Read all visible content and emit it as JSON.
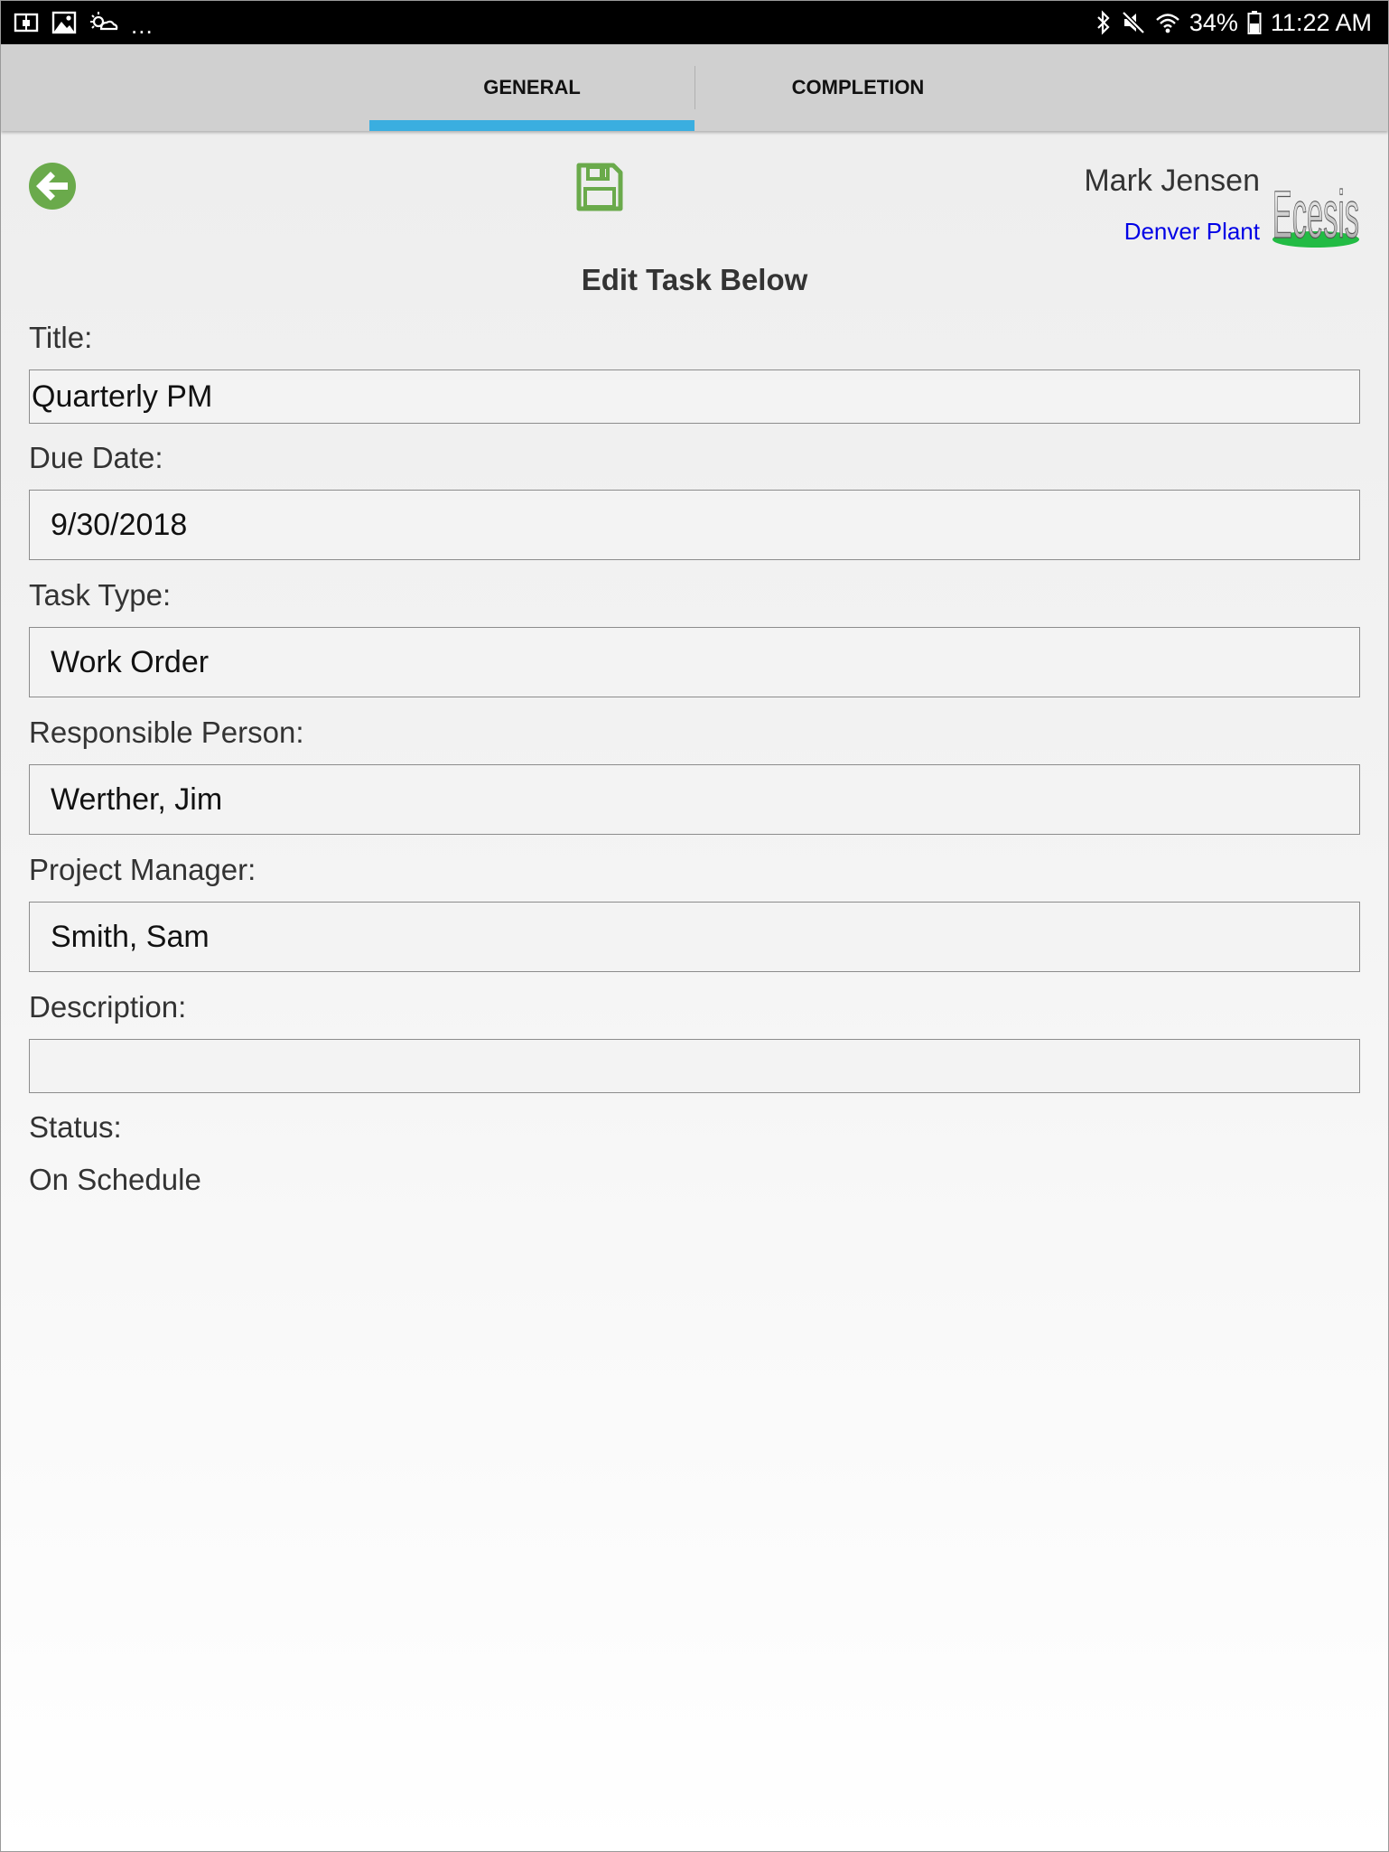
{
  "status_bar": {
    "dots": "...",
    "battery": "34%",
    "time": "11:22 AM"
  },
  "tabs": [
    {
      "label": "GENERAL",
      "active": true
    },
    {
      "label": "COMPLETION",
      "active": false
    }
  ],
  "header": {
    "user_name": "Mark Jensen",
    "plant": "Denver Plant",
    "logo_text": "Ecesis",
    "accent_color": "#6aaa4b",
    "tab_indicator_color": "#3aaee0",
    "plant_color": "#0000e6"
  },
  "form": {
    "heading": "Edit Task Below",
    "title_label": "Title:",
    "title_value": "Quarterly PM",
    "due_date_label": "Due Date:",
    "due_date_value": "9/30/2018",
    "task_type_label": "Task Type:",
    "task_type_value": "Work Order",
    "responsible_label": "Responsible Person:",
    "responsible_value": "Werther, Jim",
    "manager_label": "Project Manager:",
    "manager_value": "Smith, Sam",
    "description_label": "Description:",
    "description_value": "",
    "status_label": "Status:",
    "status_value": "On Schedule"
  }
}
